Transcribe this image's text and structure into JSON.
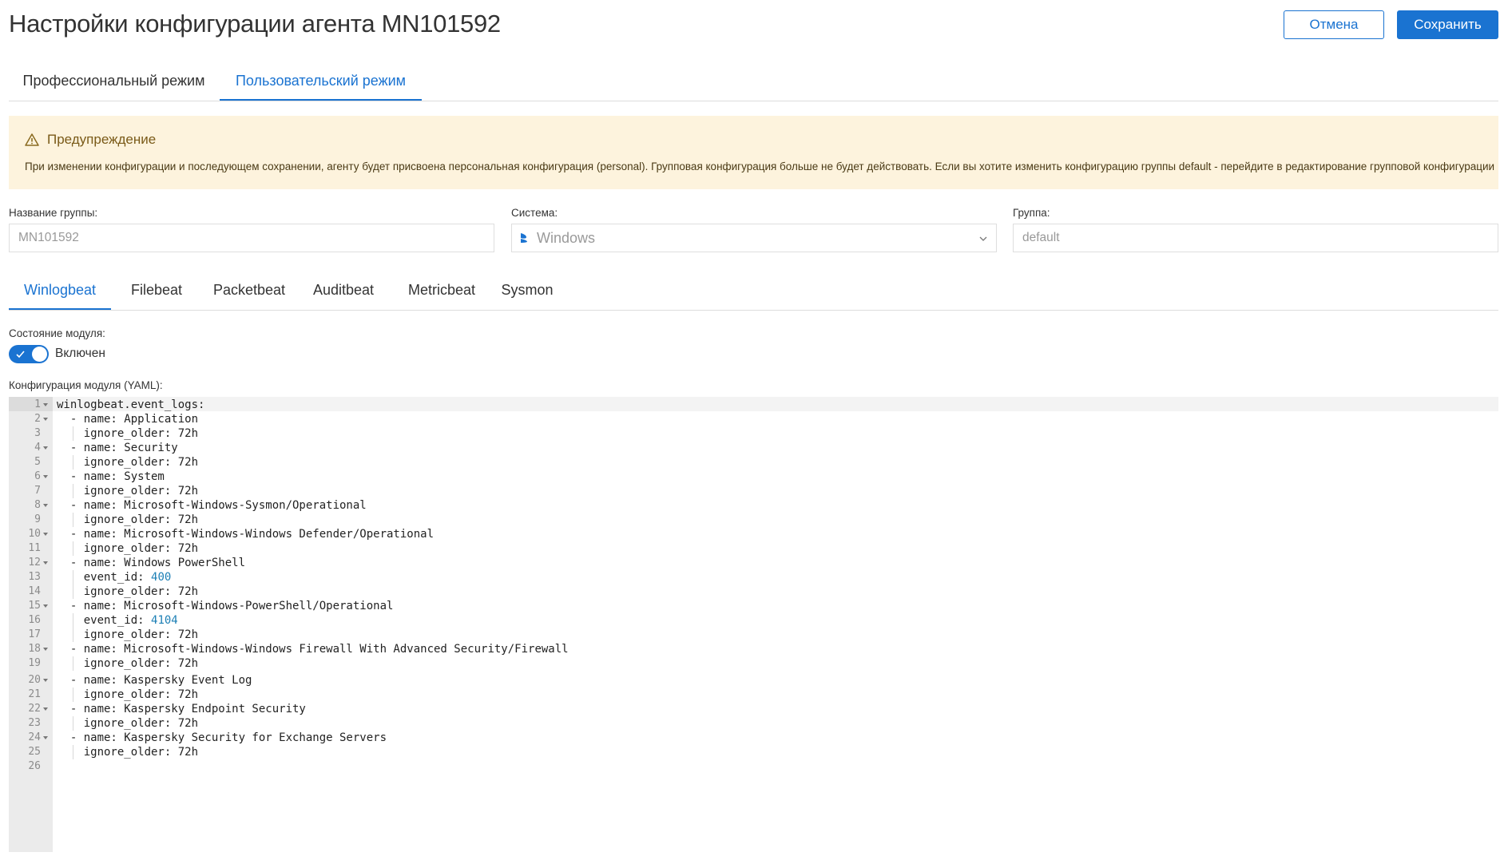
{
  "header": {
    "title": "Настройки конфигурации агента MN101592",
    "cancel_label": "Отмена",
    "save_label": "Сохранить"
  },
  "mode_tabs": [
    {
      "label": "Профессиональный режим",
      "active": false
    },
    {
      "label": "Пользовательский режим",
      "active": true
    }
  ],
  "warning": {
    "title": "Предупреждение",
    "text": "При изменении конфигурации и последующем сохранении, агенту будет присвоена персональная конфигурация (personal). Групповая конфигурация больше не будет действовать. Если вы хотите изменить конфигурацию группы default - перейдите в редактирование групповой конфигурации"
  },
  "fields": {
    "group_name_label": "Название группы:",
    "group_name_value": "MN101592",
    "system_label": "Система:",
    "system_value": "Windows",
    "group_label": "Группа:",
    "group_value": "default"
  },
  "module_tabs": [
    {
      "label": "Winlogbeat",
      "active": true
    },
    {
      "label": "Filebeat",
      "active": false
    },
    {
      "label": "Packetbeat",
      "active": false
    },
    {
      "label": "Auditbeat",
      "active": false
    },
    {
      "label": "Metricbeat",
      "active": false
    },
    {
      "label": "Sysmon",
      "active": false
    }
  ],
  "module_state": {
    "label": "Состояние модуля:",
    "toggle_text": "Включен",
    "enabled": true
  },
  "yaml": {
    "label": "Конфигурация модуля (YAML):",
    "lines": [
      {
        "n": "1",
        "fold": true,
        "text": "winlogbeat.event_logs:"
      },
      {
        "n": "2",
        "fold": true,
        "text": "  - name: Application"
      },
      {
        "n": "3",
        "fold": false,
        "text": "    ignore_older: 72h"
      },
      {
        "n": "4",
        "fold": true,
        "text": "  - name: Security"
      },
      {
        "n": "5",
        "fold": false,
        "text": "    ignore_older: 72h"
      },
      {
        "n": "6",
        "fold": true,
        "text": "  - name: System"
      },
      {
        "n": "7",
        "fold": false,
        "text": "    ignore_older: 72h"
      },
      {
        "n": "8",
        "fold": true,
        "text": "  - name: Microsoft-Windows-Sysmon/Operational"
      },
      {
        "n": "9",
        "fold": false,
        "text": "    ignore_older: 72h"
      },
      {
        "n": "10",
        "fold": true,
        "text": "  - name: Microsoft-Windows-Windows Defender/Operational"
      },
      {
        "n": "11",
        "fold": false,
        "text": "    ignore_older: 72h"
      },
      {
        "n": "12",
        "fold": true,
        "text": "  - name: Windows PowerShell"
      },
      {
        "n": "13",
        "fold": false,
        "text": "    event_id: ",
        "num": "400"
      },
      {
        "n": "14",
        "fold": false,
        "text": "    ignore_older: 72h"
      },
      {
        "n": "15",
        "fold": true,
        "text": "  - name: Microsoft-Windows-PowerShell/Operational"
      },
      {
        "n": "16",
        "fold": false,
        "text": "    event_id: ",
        "num": "4104"
      },
      {
        "n": "17",
        "fold": false,
        "text": "    ignore_older: 72h"
      },
      {
        "n": "18",
        "fold": true,
        "text": "  - name: Microsoft-Windows-Windows Firewall With Advanced Security/Firewall"
      },
      {
        "n": "19",
        "fold": false,
        "text": "    ignore_older: 72h"
      },
      {
        "n": "20",
        "fold": true,
        "text": "  - name: Kaspersky Event Log"
      },
      {
        "n": "21",
        "fold": false,
        "text": "    ignore_older: 72h"
      },
      {
        "n": "22",
        "fold": true,
        "text": "  - name: Kaspersky Endpoint Security"
      },
      {
        "n": "23",
        "fold": false,
        "text": "    ignore_older: 72h"
      },
      {
        "n": "24",
        "fold": true,
        "text": "  - name: Kaspersky Security for Exchange Servers"
      },
      {
        "n": "25",
        "fold": false,
        "text": "    ignore_older: 72h"
      },
      {
        "n": "26",
        "fold": false,
        "text": ""
      }
    ]
  },
  "colors": {
    "accent": "#1a73d1",
    "warning_bg": "#fdf3dd",
    "number": "#1c7fb5"
  }
}
